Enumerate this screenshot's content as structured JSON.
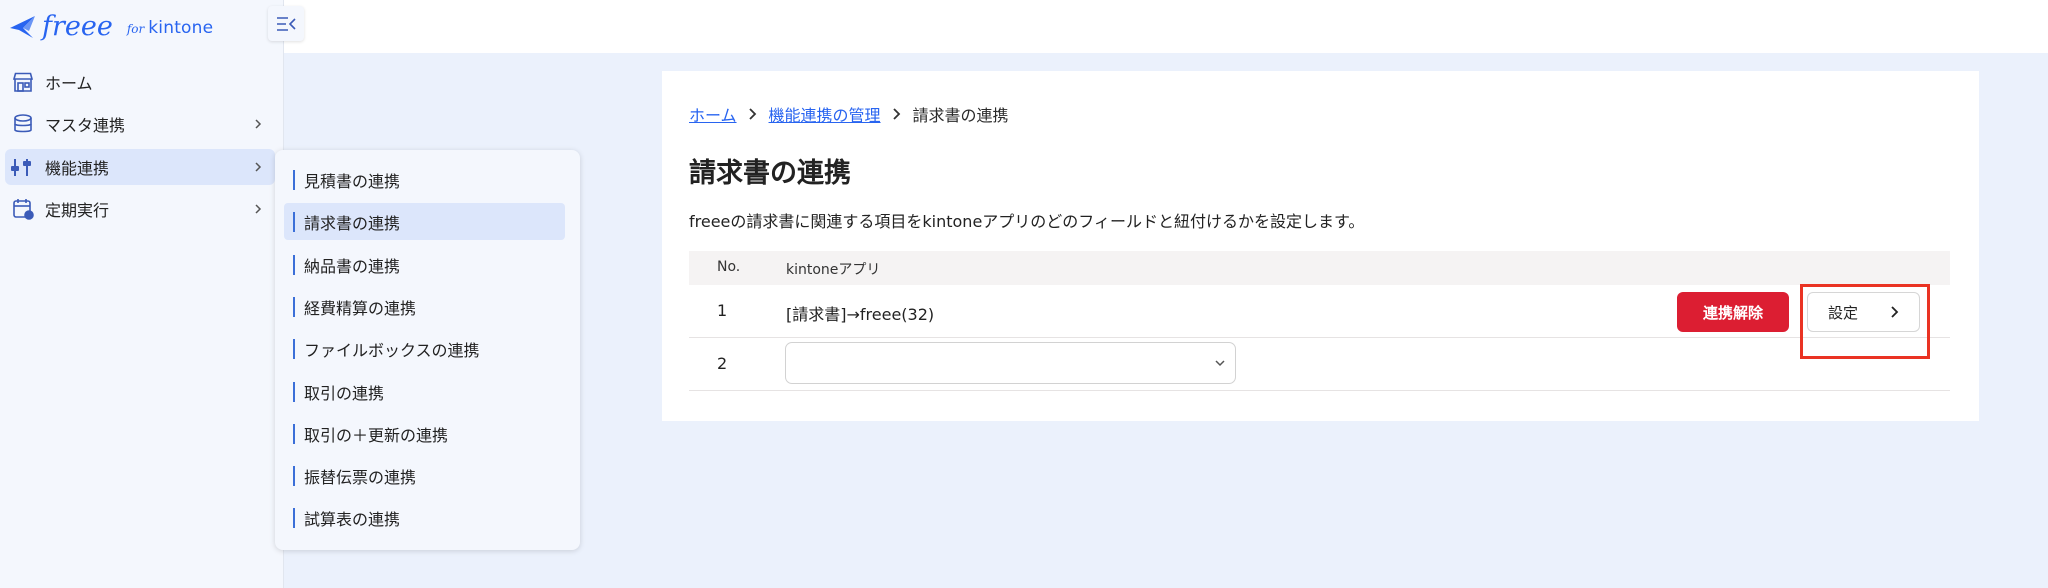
{
  "logo": {
    "brand": "freee",
    "for": "for",
    "product": "kintone"
  },
  "sidebar": {
    "items": [
      {
        "label": "ホーム",
        "icon": "store-icon"
      },
      {
        "label": "マスタ連携",
        "icon": "database-icon"
      },
      {
        "label": "機能連携",
        "icon": "sliders-icon",
        "active": true
      },
      {
        "label": "定期実行",
        "icon": "calendar-clock-icon"
      }
    ]
  },
  "submenu": {
    "items": [
      {
        "label": "見積書の連携"
      },
      {
        "label": "請求書の連携",
        "active": true
      },
      {
        "label": "納品書の連携"
      },
      {
        "label": "経費精算の連携"
      },
      {
        "label": "ファイルボックスの連携"
      },
      {
        "label": "取引の連携"
      },
      {
        "label": "取引の＋更新の連携"
      },
      {
        "label": "振替伝票の連携"
      },
      {
        "label": "試算表の連携"
      }
    ]
  },
  "breadcrumb": {
    "home": "ホーム",
    "parent": "機能連携の管理",
    "current": "請求書の連携"
  },
  "main": {
    "title": "請求書の連携",
    "description": "freeeの請求書に関連する項目をkintoneアプリのどのフィールドと紐付けるかを設定します。",
    "table": {
      "headers": {
        "no": "No.",
        "app": "kintoneアプリ"
      },
      "rows": [
        {
          "no": "1",
          "app": "[請求書]→freee(32)",
          "unlink_label": "連携解除",
          "settings_label": "設定"
        },
        {
          "no": "2",
          "app": "",
          "select_value": ""
        }
      ]
    }
  },
  "colors": {
    "accent": "#2864f0",
    "danger": "#dc1e32",
    "highlight": "#ea3323",
    "background": "#ebf1fc"
  }
}
